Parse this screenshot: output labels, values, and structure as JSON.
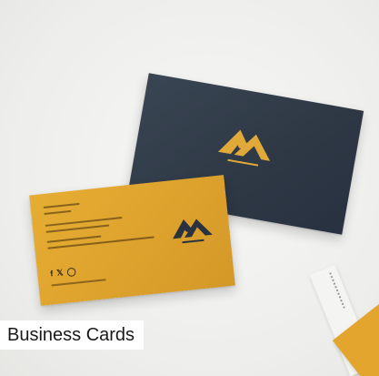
{
  "caption": {
    "text": "Business Cards"
  },
  "colors": {
    "navy_card": "#2e3845",
    "gold_card": "#dca12c",
    "logo_gold": "#e0a93a",
    "logo_dark": "#2a3240"
  },
  "icons": {
    "navy_logo": "mountain-logo-icon",
    "gold_logo": "mountain-logo-icon",
    "social": [
      "facebook-icon",
      "twitter-icon",
      "instagram-icon"
    ]
  }
}
